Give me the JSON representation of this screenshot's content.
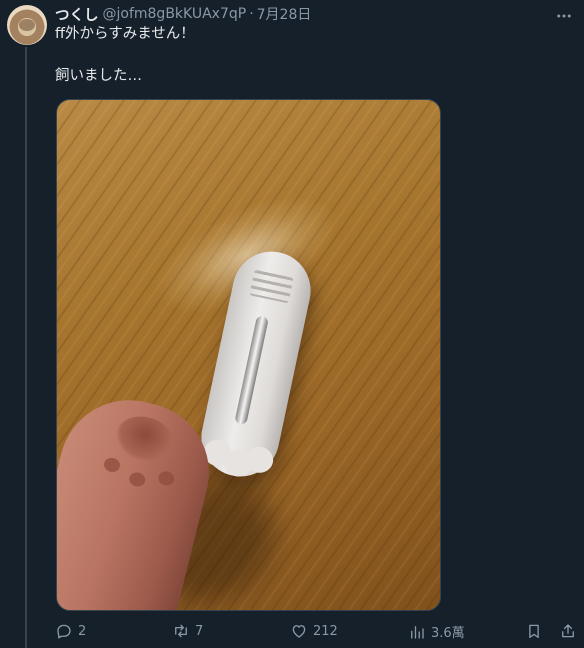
{
  "tweet": {
    "author_name": "つくし",
    "handle": "@jofm8gBkKUAx7qP",
    "separator": "·",
    "date": "7月28日",
    "text_lines": [
      "ff外からすみません！",
      "飼いました…"
    ]
  },
  "actions": {
    "replies": "2",
    "retweets": "7",
    "likes": "212",
    "views": "3.6萬"
  },
  "icons": {
    "more": "more-icon",
    "reply": "reply-icon",
    "retweet": "retweet-icon",
    "like": "heart-icon",
    "views": "views-icon",
    "bookmark": "bookmark-icon",
    "share": "share-icon"
  },
  "colors": {
    "background": "#15202b",
    "text": "#e7e9ea",
    "muted": "#8b98a5",
    "border": "#38444d"
  }
}
